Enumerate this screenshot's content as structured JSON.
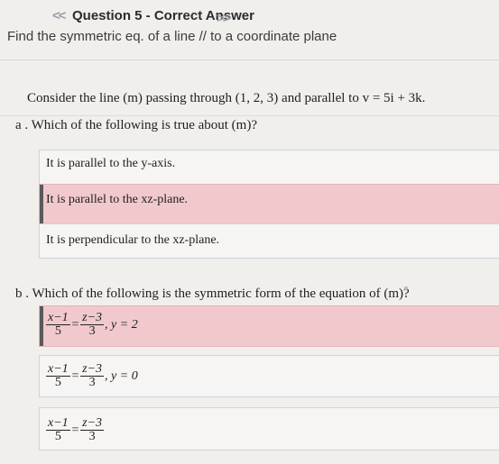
{
  "header": {
    "prev_label": "<<",
    "title": "Question 5 - Correct Answer",
    "next_label": ">>",
    "subtitle": "Find the symmetric eq. of a line // to a coordinate plane"
  },
  "prompt": "Consider the line (m) passing through (1, 2, 3) and parallel to v = 5i + 3k.",
  "part_a": {
    "question": "a .  Which of the following is true about (m)?",
    "options": [
      "It is parallel to the y-axis.",
      "It is parallel to the xz-plane.",
      "It is perpendicular to the xz-plane."
    ],
    "selected_index": 1
  },
  "part_b": {
    "question": "b .  Which of the following is the symmetric form of the equation of (m)?",
    "options": [
      {
        "num1": "x−1",
        "den1": "5",
        "num2": "z−3",
        "den2": "3",
        "extra": ", y = 2"
      },
      {
        "num1": "x−1",
        "den1": "5",
        "num2": "z−3",
        "den2": "3",
        "extra": ", y = 0"
      },
      {
        "num1": "x−1",
        "den1": "5",
        "num2": "z−3",
        "den2": "3",
        "extra": ""
      }
    ],
    "selected_index": 0
  },
  "colors": {
    "correct_bg": "#f1c9cd",
    "option_border": "#cdd3d9",
    "page_bg": "#f1efec"
  }
}
